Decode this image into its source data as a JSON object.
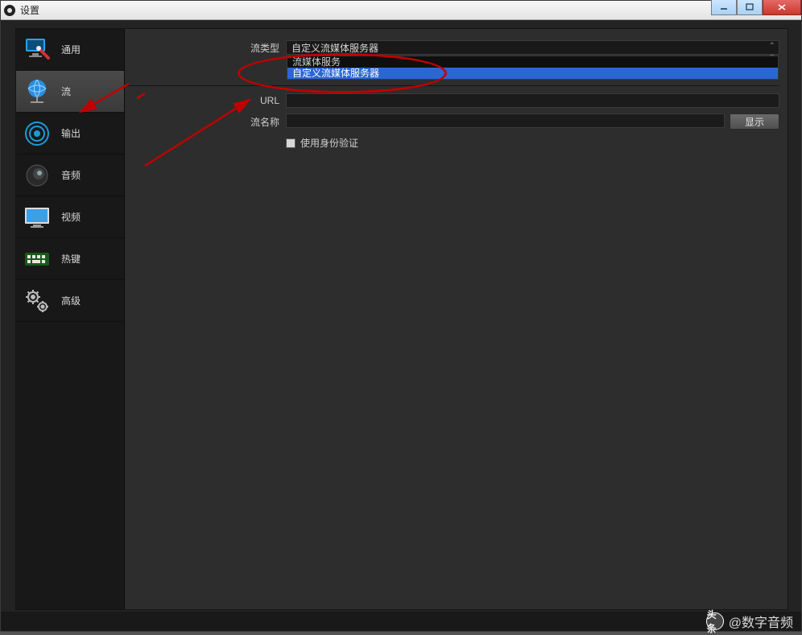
{
  "titlebar": {
    "title": "设置"
  },
  "sidebar": {
    "items": [
      {
        "label": "通用"
      },
      {
        "label": "流"
      },
      {
        "label": "输出"
      },
      {
        "label": "音频"
      },
      {
        "label": "视频"
      },
      {
        "label": "热键"
      },
      {
        "label": "高级"
      }
    ],
    "selected_index": 1
  },
  "form": {
    "stream_type_label": "流类型",
    "stream_type_value": "自定义流媒体服务器",
    "stream_type_options": [
      "流媒体服务",
      "自定义流媒体服务器"
    ],
    "url_label": "URL",
    "url_value": "",
    "stream_key_label": "流名称",
    "stream_key_value": "",
    "show_button": "显示",
    "use_auth_label": "使用身份验证"
  },
  "watermark": {
    "logo_text": "头条",
    "handle": "@数字音频"
  }
}
